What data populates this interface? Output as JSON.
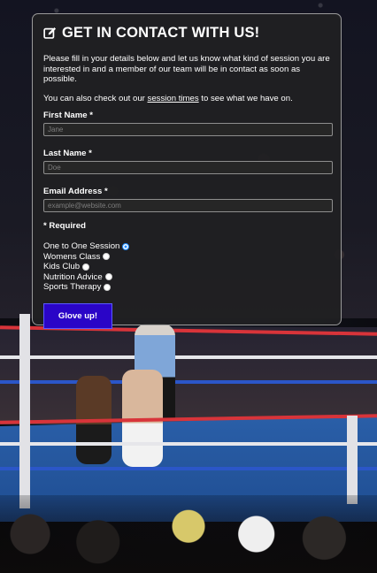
{
  "form": {
    "title": "GET IN CONTACT WITH US!",
    "intro": "Please fill in your details below and let us know what kind of session you are interested in and a member of our team will be in contact as soon as possible.",
    "intro2_before": "You can also check out our ",
    "intro2_link": "session times",
    "intro2_after": " to see what we have on.",
    "fields": {
      "first_name": {
        "label": "First Name *",
        "placeholder": "Jane",
        "value": ""
      },
      "last_name": {
        "label": "Last Name *",
        "placeholder": "Doe",
        "value": ""
      },
      "email": {
        "label": "Email Address *",
        "placeholder": "example@website.com",
        "value": ""
      }
    },
    "required_note": "* Required",
    "sessions": [
      {
        "label": "One to One Session",
        "checked": true
      },
      {
        "label": "Womens Class",
        "checked": false
      },
      {
        "label": "Kids Club",
        "checked": false
      },
      {
        "label": "Nutrition Advice",
        "checked": false
      },
      {
        "label": "Sports Therapy",
        "checked": false
      }
    ],
    "submit_label": "Glove up!"
  },
  "icons": {
    "title_icon": "edit-icon"
  },
  "colors": {
    "submit_bg": "#2a05c7",
    "card_bg": "#202022",
    "radio_accent": "#1f8bff"
  }
}
